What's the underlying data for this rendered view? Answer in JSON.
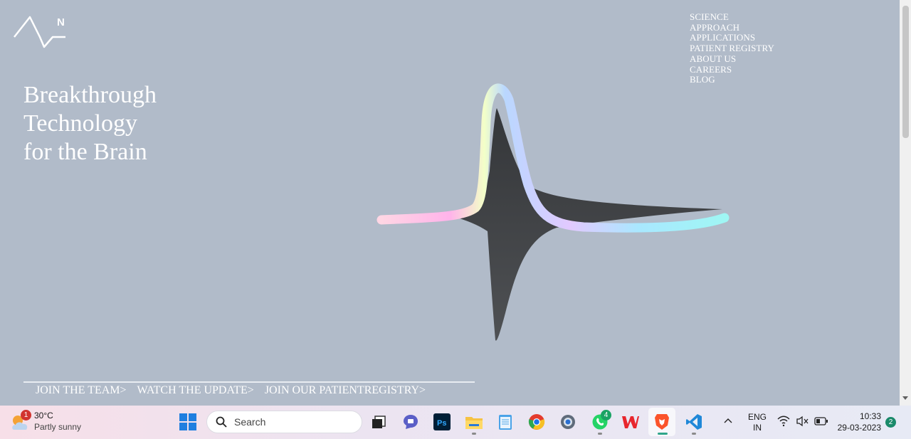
{
  "site": {
    "logo_letter": "N",
    "nav": [
      "SCIENCE",
      "APPROACH",
      "APPLICATIONS",
      "PATIENT REGISTRY",
      "ABOUT US",
      "CAREERS",
      "BLOG"
    ],
    "hero_lines": [
      "Breakthrough",
      "Technology",
      "for the Brain"
    ],
    "ctas": [
      "JOIN THE TEAM>",
      "WATCH THE UPDATE>",
      "JOIN OUR PATIENTREGISTRY>"
    ],
    "colors": {
      "background": "#b1bbc9",
      "text": "#ffffff"
    }
  },
  "taskbar": {
    "weather": {
      "badge": "1",
      "temp": "30°C",
      "condition": "Partly sunny",
      "icon": "partly-sunny-icon"
    },
    "search_placeholder": "Search",
    "apps": [
      {
        "name": "windows-start-icon"
      },
      {
        "name": "task-view-icon"
      },
      {
        "name": "teams-chat-icon"
      },
      {
        "name": "photoshop-icon",
        "label": "Ps"
      },
      {
        "name": "file-explorer-icon"
      },
      {
        "name": "notepad-icon"
      },
      {
        "name": "chrome-icon"
      },
      {
        "name": "settings-icon"
      },
      {
        "name": "whatsapp-icon",
        "badge": "4"
      },
      {
        "name": "wps-office-icon"
      },
      {
        "name": "brave-browser-icon"
      },
      {
        "name": "vscode-icon"
      }
    ],
    "tray": {
      "lang_top": "ENG",
      "lang_bottom": "IN",
      "time": "10:33",
      "date": "29-03-2023",
      "notifications": "2"
    }
  }
}
